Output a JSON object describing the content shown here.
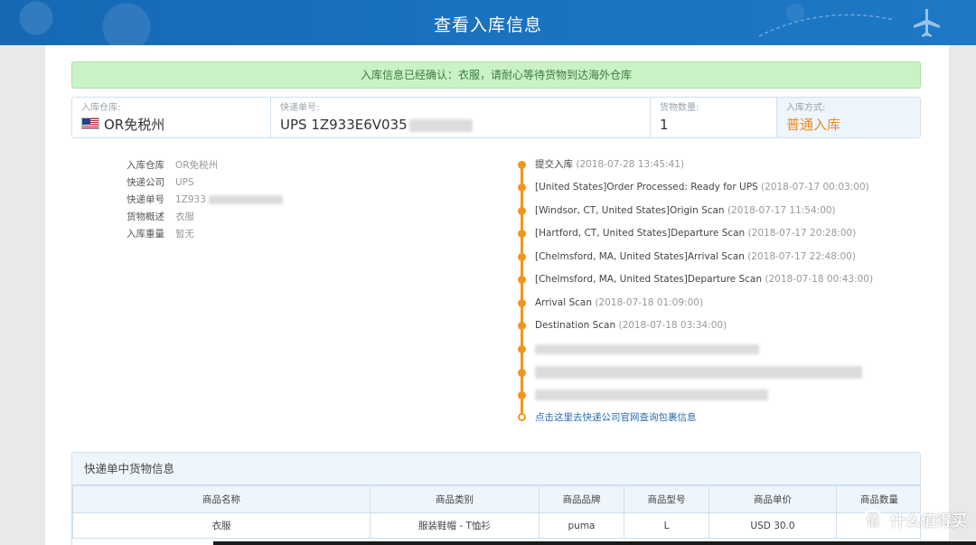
{
  "header": {
    "title": "查看入库信息"
  },
  "alert": {
    "text": "入库信息已经确认：衣服，请耐心等待货物到达海外仓库"
  },
  "summary": {
    "warehouse": {
      "label": "入库仓库:",
      "value": "OR免税州"
    },
    "tracking": {
      "label": "快递单号:",
      "value": "UPS 1Z933E6V035"
    },
    "quantity": {
      "label": "货物数量:",
      "value": "1"
    },
    "method": {
      "label": "入库方式:",
      "value": "普通入库"
    }
  },
  "details": [
    {
      "key": "入库仓库",
      "value": "OR免税州"
    },
    {
      "key": "快递公司",
      "value": "UPS"
    },
    {
      "key": "快递单号",
      "value": "1Z933"
    },
    {
      "key": "货物概述",
      "value": "衣服"
    },
    {
      "key": "入库重量",
      "value": "暂无"
    }
  ],
  "timeline": {
    "events": [
      {
        "text": "提交入库",
        "time": "(2018-07-28 13:45:41)"
      },
      {
        "text": "[United States]Order Processed: Ready for UPS",
        "time": "(2018-07-17 00:03:00)"
      },
      {
        "text": "[Windsor,  CT, United States]Origin Scan",
        "time": "(2018-07-17 11:54:00)"
      },
      {
        "text": "[Hartford,  CT, United States]Departure Scan",
        "time": "(2018-07-17 20:28:00)"
      },
      {
        "text": "[Chelmsford,  MA, United States]Arrival Scan",
        "time": "(2018-07-17 22:48:00)"
      },
      {
        "text": "[Chelmsford,  MA, United States]Departure Scan",
        "time": "(2018-07-18 00:43:00)"
      },
      {
        "text": "Arrival Scan",
        "time": "(2018-07-18 01:09:00)"
      },
      {
        "text": "Destination Scan",
        "time": "(2018-07-18 03:34:00)"
      }
    ],
    "link_text": "点击这里去快递公司官网查询包裹信息"
  },
  "goods": {
    "title": "快递单中货物信息",
    "columns": [
      "商品名称",
      "商品类别",
      "商品品牌",
      "商品型号",
      "商品单价",
      "商品数量"
    ],
    "rows": [
      [
        "衣服",
        "服装鞋帽 - T恤衫",
        "puma",
        "L",
        "USD 30.0",
        ""
      ]
    ]
  },
  "watermark": {
    "icon_text": "值",
    "text": "什么值得买"
  },
  "colors": {
    "header_blue": "#1a72c0",
    "accent_orange": "#f2951e",
    "alert_green": "#c9f3c6",
    "link_blue": "#2b6cb0"
  }
}
